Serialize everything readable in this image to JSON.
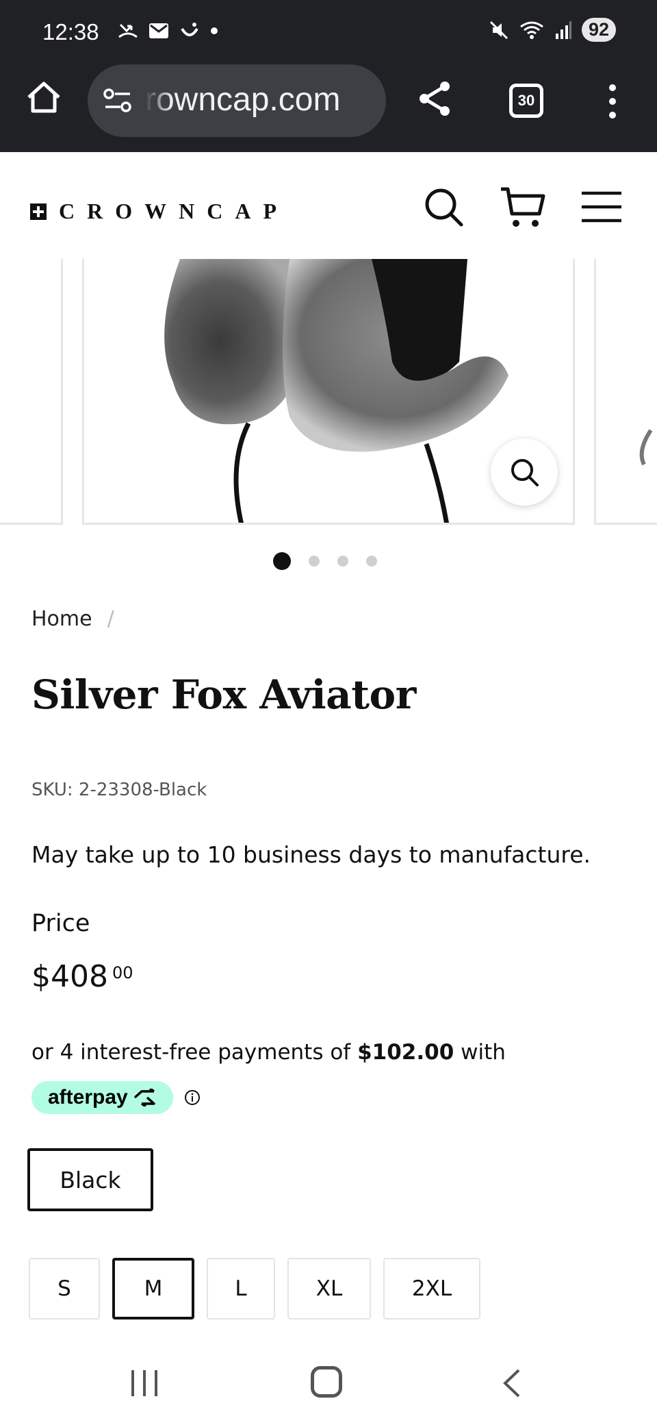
{
  "status_bar": {
    "time": "12:38",
    "battery": "92"
  },
  "browser": {
    "url": "rowncap.com",
    "tab_count": "30"
  },
  "site": {
    "logo_text": "CROWNCAP"
  },
  "gallery": {
    "slide_count": 4,
    "active_index": 0
  },
  "product": {
    "breadcrumb_home": "Home",
    "breadcrumb_sep": "/",
    "title": "Silver Fox Aviator",
    "sku": "SKU: 2-23308-Black",
    "manufacture_note": "May take up to 10 business days to manufacture.",
    "price_label": "Price",
    "price_main": "$408",
    "price_cents": "00",
    "afterpay_prefix": "or 4 interest-free payments of",
    "afterpay_amount": "$102.00",
    "afterpay_suffix": "with",
    "afterpay_brand": "afterpay",
    "color": "Black",
    "sizes": [
      "S",
      "M",
      "L",
      "XL",
      "2XL"
    ],
    "selected_size": "M"
  },
  "colors": {
    "chrome_bg": "#202124",
    "afterpay_mint": "#b2fce4"
  }
}
